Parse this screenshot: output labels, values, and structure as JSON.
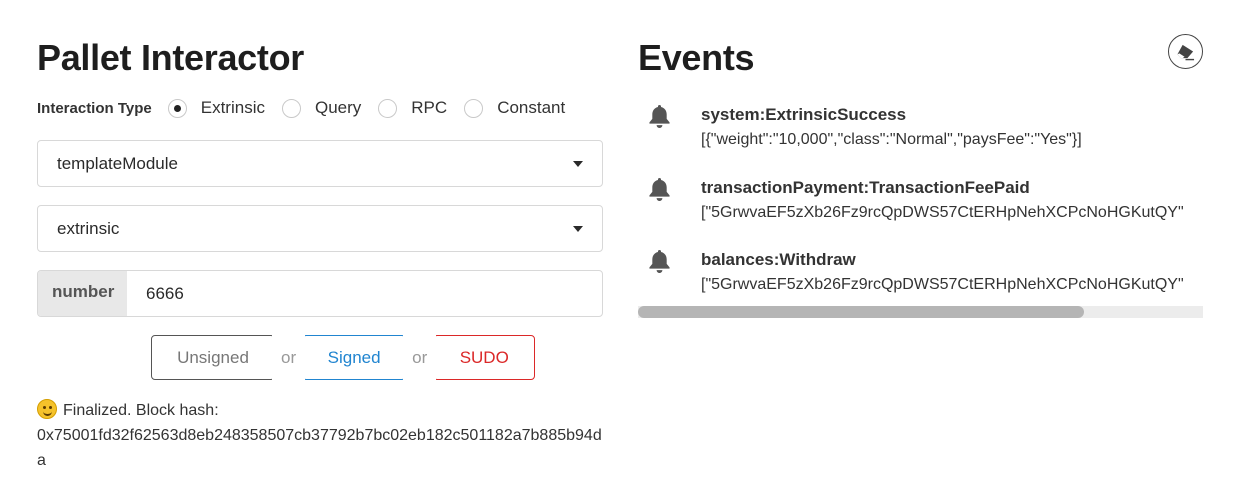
{
  "pallet": {
    "title": "Pallet Interactor",
    "interaction_label": "Interaction Type",
    "interaction_options": [
      {
        "label": "Extrinsic",
        "selected": true
      },
      {
        "label": "Query",
        "selected": false
      },
      {
        "label": "RPC",
        "selected": false
      },
      {
        "label": "Constant",
        "selected": false
      }
    ],
    "pallet_select": "templateModule",
    "callable_select": "extrinsic",
    "param_label": "number",
    "param_value": "6666",
    "buttons": {
      "unsigned": "Unsigned",
      "or1": "or",
      "signed": "Signed",
      "or2": "or",
      "sudo": "SUDO"
    },
    "status_text": "Finalized. Block hash:",
    "block_hash": "0x75001fd32f62563d8eb248358507cb37792b7bc02eb182c501182a7b885b94da"
  },
  "events": {
    "title": "Events",
    "items": [
      {
        "name": "system:ExtrinsicSuccess",
        "data": "[{\"weight\":\"10,000\",\"class\":\"Normal\",\"paysFee\":\"Yes\"}]"
      },
      {
        "name": "transactionPayment:TransactionFeePaid",
        "data": "[\"5GrwvaEF5zXb26Fz9rcQpDWS57CtERHpNehXCPcNoHGKutQY\""
      },
      {
        "name": "balances:Withdraw",
        "data": "[\"5GrwvaEF5zXb26Fz9rcQpDWS57CtERHpNehXCPcNoHGKutQY\""
      }
    ],
    "scroll_fraction": 0.79
  },
  "colors": {
    "signed": "#2185d0",
    "sudo": "#db2828",
    "unsigned": "#555555"
  },
  "icons": {
    "bell": "bell-icon",
    "eraser": "eraser-icon",
    "smiley": "smiley-icon",
    "caret": "caret-down-icon"
  }
}
